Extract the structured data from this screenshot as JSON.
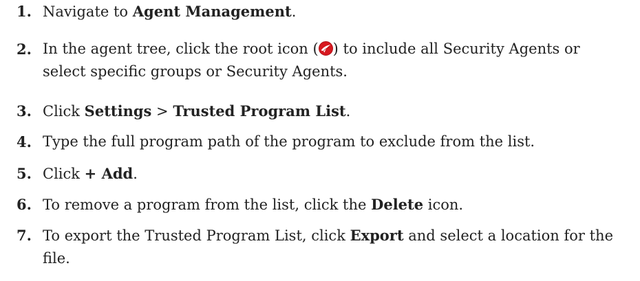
{
  "steps": [
    {
      "num": "1.",
      "parts": [
        "Navigate to ",
        "Agent Management",
        "."
      ]
    },
    {
      "num": "2.",
      "parts": [
        "In the agent tree, click the root icon (",
        ") to include all Security Agents or select specific groups or Security Agents."
      ]
    },
    {
      "num": "3.",
      "parts": [
        "Click ",
        "Settings",
        " > ",
        "Trusted Program List",
        "."
      ]
    },
    {
      "num": "4.",
      "parts": [
        "Type the full program path of the program to exclude from the list."
      ]
    },
    {
      "num": "5.",
      "parts": [
        "Click ",
        "+ Add",
        "."
      ]
    },
    {
      "num": "6.",
      "parts": [
        "To remove a program from the list, click the ",
        "Delete",
        " icon."
      ]
    },
    {
      "num": "7.",
      "parts": [
        "To export the Trusted Program List, click ",
        "Export",
        " and select a location for the file."
      ]
    }
  ],
  "colors": {
    "text": "#222222",
    "root_icon_red": "#d71920"
  },
  "icons": {
    "root": "trend-micro-root-icon"
  }
}
